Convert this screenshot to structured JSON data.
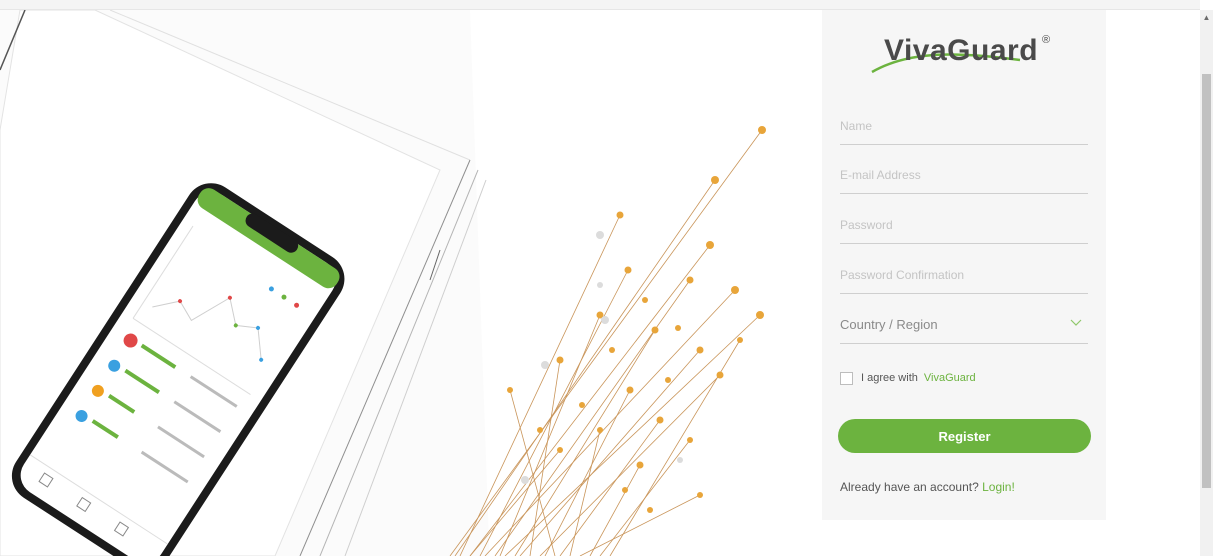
{
  "brand": {
    "name": "VivaGuard",
    "reg_mark": "®"
  },
  "form": {
    "name_placeholder": "Name",
    "email_placeholder": "E-mail Address",
    "password_placeholder": "Password",
    "password_confirm_placeholder": "Password Confirmation",
    "country_label": "Country / Region",
    "agree_text": "I agree with",
    "agree_link": "VivaGuard",
    "register_label": "Register",
    "already_text": "Already have an account?",
    "login_link": "Login!"
  },
  "colors": {
    "accent": "#6cb33f",
    "panel_bg": "#f6f6f6",
    "text": "#555555"
  }
}
